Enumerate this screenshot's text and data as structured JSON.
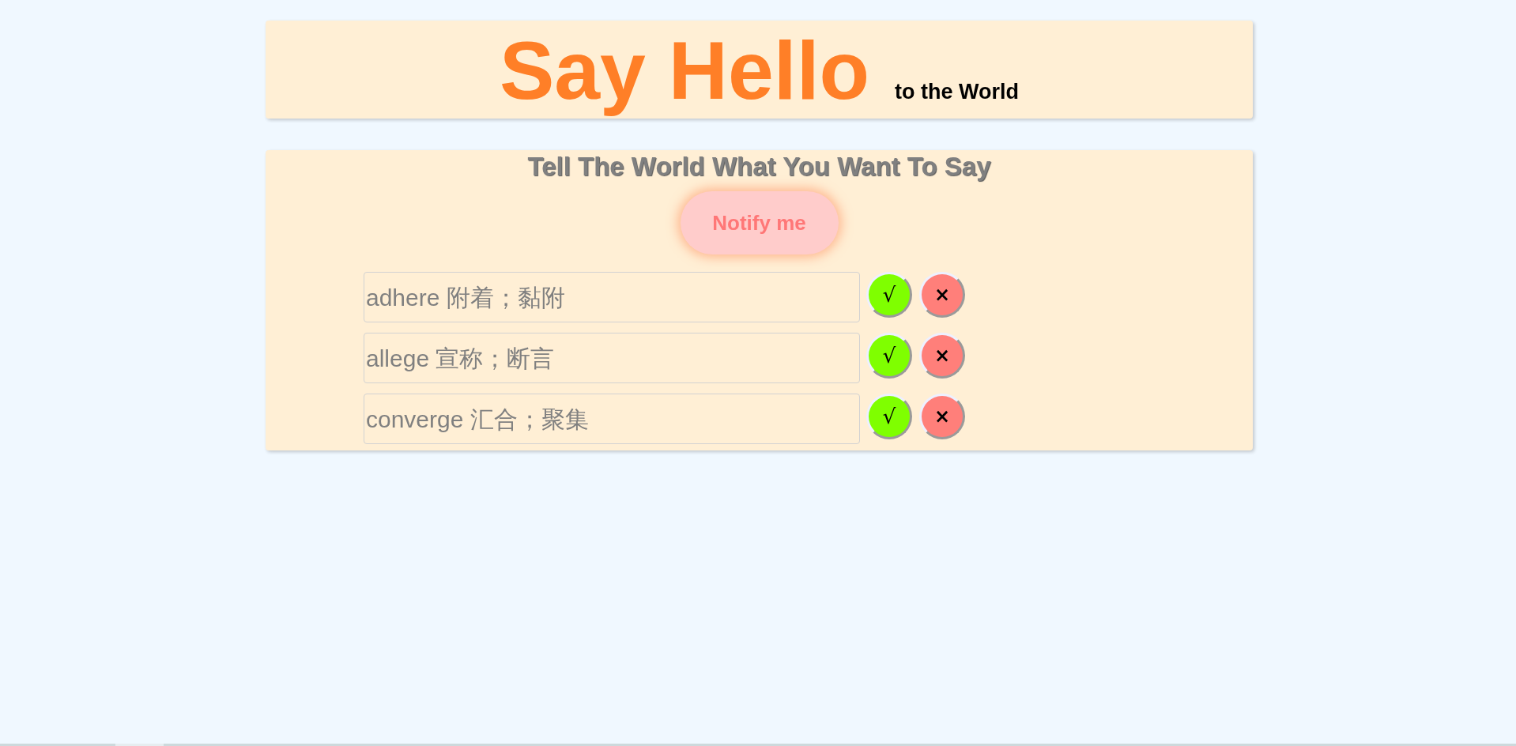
{
  "header": {
    "title": "Say Hello",
    "subtitle": "to the World"
  },
  "panel": {
    "title": "Tell The World What You Want To Say",
    "button": "Notify me",
    "items": [
      {
        "value": "adhere 附着；黏附",
        "confirm": "√",
        "remove": "×"
      },
      {
        "value": "allege 宣称；断言",
        "confirm": "√",
        "remove": "×"
      },
      {
        "value": "converge 汇合；聚集",
        "confirm": "√",
        "remove": "×"
      }
    ]
  }
}
